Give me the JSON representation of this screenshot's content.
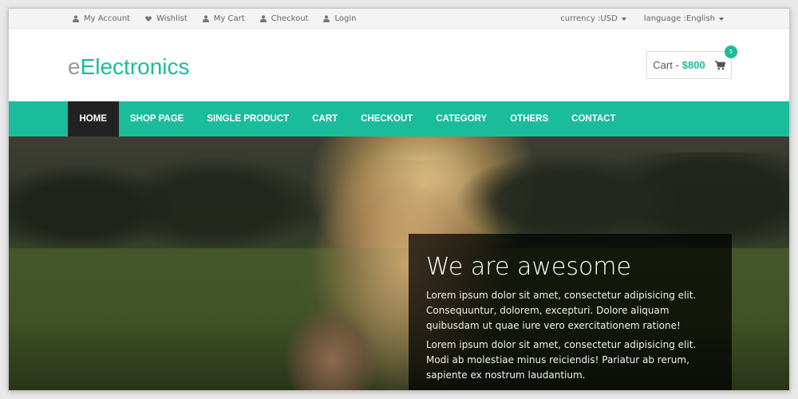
{
  "topbar": {
    "links": [
      {
        "label": "My Account",
        "icon": "user-icon"
      },
      {
        "label": "Wishlist",
        "icon": "heart-icon"
      },
      {
        "label": "My Cart",
        "icon": "user-icon"
      },
      {
        "label": "Checkout",
        "icon": "user-icon"
      },
      {
        "label": "Login",
        "icon": "user-icon"
      }
    ],
    "currency": "currency :USD",
    "language": "language :English"
  },
  "header": {
    "logo_prefix": "e",
    "logo_main": "Electronics",
    "cart_label": "Cart -",
    "cart_amount": "$800",
    "cart_count": "5"
  },
  "nav": {
    "items": [
      "HOME",
      "SHOP PAGE",
      "SINGLE PRODUCT",
      "CART",
      "CHECKOUT",
      "CATEGORY",
      "OTHERS",
      "CONTACT"
    ],
    "active": "HOME"
  },
  "hero": {
    "title": "We are awesome",
    "paragraph1": "Lorem ipsum dolor sit amet, consectetur adipisicing elit. Consequuntur, dolorem, excepturi. Dolore aliquam quibusdam ut quae iure vero exercitationem ratione!",
    "paragraph2": "Lorem ipsum dolor sit amet, consectetur adipisicing elit. Modi ab molestiae minus reiciendis! Pariatur ab rerum, sapiente ex nostrum laudantium."
  },
  "colors": {
    "accent": "#1abc9c",
    "nav_active": "#222222"
  }
}
